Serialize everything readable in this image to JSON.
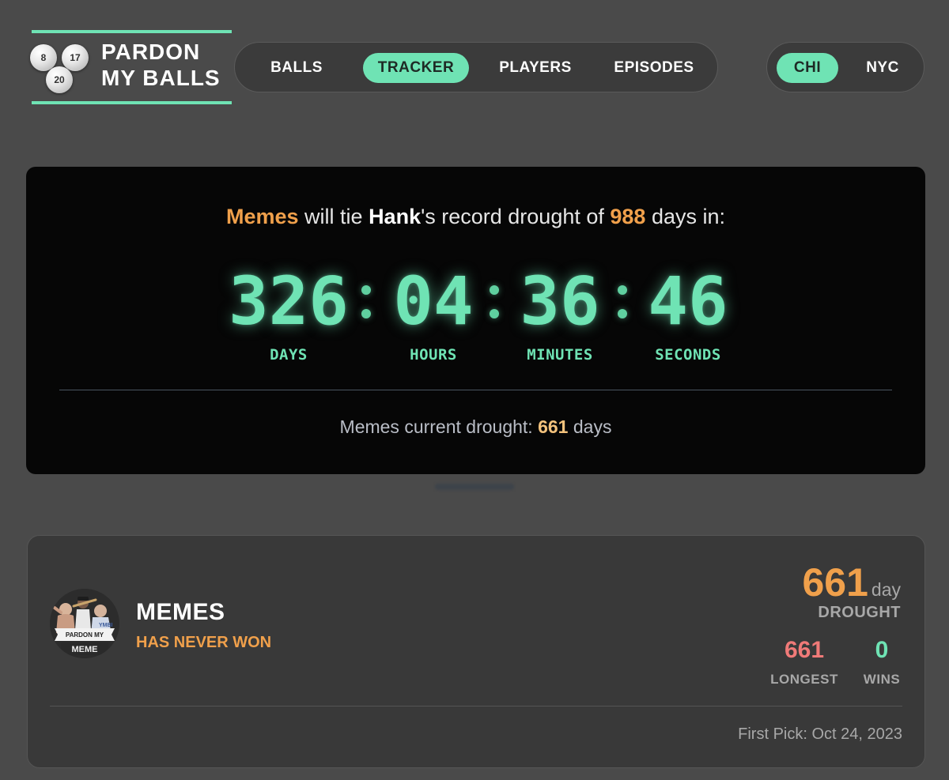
{
  "header": {
    "logo": {
      "title_line1": "PARDON",
      "title_line2": "MY BALLS",
      "balls": [
        "8",
        "17",
        "20"
      ]
    },
    "nav": [
      {
        "label": "BALLS",
        "active": false
      },
      {
        "label": "TRACKER",
        "active": true
      },
      {
        "label": "PLAYERS",
        "active": false
      },
      {
        "label": "EPISODES",
        "active": false
      }
    ],
    "city": [
      {
        "label": "CHI",
        "active": true
      },
      {
        "label": "NYC",
        "active": false
      }
    ]
  },
  "countdown": {
    "player": "Memes",
    "text_will_tie": "will tie",
    "record_holder": "Hank",
    "text_record": "'s record drought of",
    "record_days": "988",
    "text_days_in": "days in:",
    "days": "326",
    "hours": "04",
    "minutes": "36",
    "seconds": "46",
    "unit_days": "DAYS",
    "unit_hours": "HOURS",
    "unit_minutes": "MINUTES",
    "unit_seconds": "SECONDS",
    "current_label": "Memes current drought:",
    "current_value": "661",
    "current_unit": "days"
  },
  "player_card": {
    "avatar_text_top": "PARDON MY",
    "avatar_text_bottom": "MEME",
    "name": "MEMES",
    "status": "HAS NEVER WON",
    "drought_value": "661",
    "drought_unit": "day",
    "drought_label": "DROUGHT",
    "longest_value": "661",
    "longest_label": "LONGEST",
    "wins_value": "0",
    "wins_label": "WINS",
    "first_pick": "First Pick: Oct 24, 2023"
  },
  "colors": {
    "accent": "#6fe3b4",
    "orange": "#f0a04b",
    "longest_red": "#f07a78",
    "gold": "#f3c27c"
  }
}
